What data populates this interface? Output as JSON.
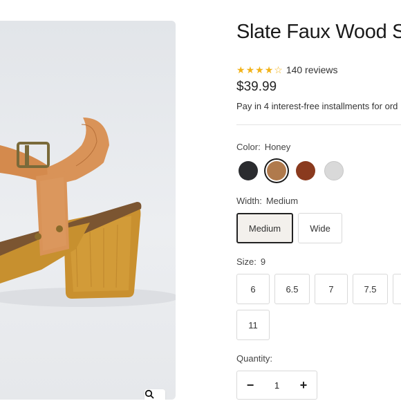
{
  "product": {
    "title": "Slate Faux Wood S",
    "rating_value": 4.5,
    "review_count_text": "140 reviews",
    "price": "$39.99",
    "installments_text": "Pay in 4 interest-free installments for ord"
  },
  "color": {
    "label": "Color:",
    "selected": "Honey",
    "swatches": [
      {
        "name": "Black",
        "hex": "#2b2c2f"
      },
      {
        "name": "Honey",
        "hex": "#b07a4c"
      },
      {
        "name": "Brown",
        "hex": "#8a3a1e"
      },
      {
        "name": "Silver",
        "hex": "#d9d9d9"
      }
    ]
  },
  "width": {
    "label": "Width:",
    "selected": "Medium",
    "options": [
      "Medium",
      "Wide"
    ]
  },
  "size": {
    "label": "Size:",
    "selected": "9",
    "options": [
      "6",
      "6.5",
      "7",
      "7.5",
      "",
      "11"
    ]
  },
  "quantity": {
    "label": "Quantity:",
    "minus": "−",
    "value": "1",
    "plus": "+"
  },
  "colors": {
    "star": "#f2b31a",
    "selected_border": "#1a1a1a",
    "border": "#d9d9d9"
  },
  "icons": {
    "zoom": "search-icon"
  }
}
